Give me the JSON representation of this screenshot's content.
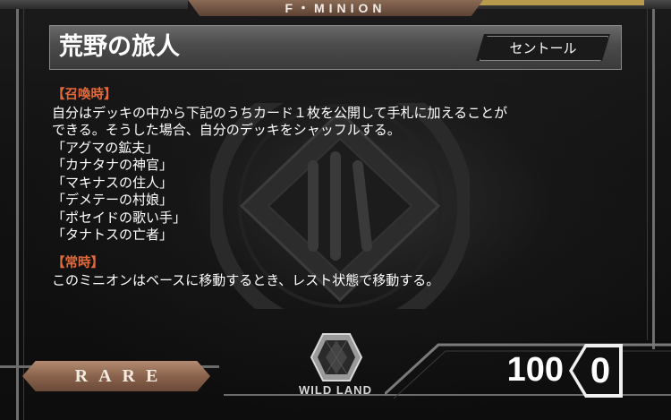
{
  "card": {
    "type": "F・MINION",
    "name": "荒野の旅人",
    "race": "セントール",
    "ability": {
      "summon_keyword": "【召喚時】",
      "summon_lines": [
        "自分はデッキの中から下記のうちカード１枚を公開して手札に加えることが",
        "できる。そうした場合、自分のデッキをシャッフルする。",
        "「アグマの鉱夫」",
        "「カナタナの神官」",
        "「マキナスの住人」",
        "「デメテーの村娘」",
        "「ポセイドの歌い手」",
        "「タナトスの亡者」"
      ],
      "constant_keyword": "【常時】",
      "constant_lines": [
        "このミニオンはベースに移動するとき、レスト状態で移動する。"
      ]
    },
    "rarity": "RARE",
    "set": "WILD LAND",
    "value": "100",
    "cost": "0"
  },
  "colors": {
    "keyword": "#e26a3a",
    "text": "#ffffff",
    "rarity_plate": "#8a634c"
  },
  "icons": {
    "emblem": "diamond-crest-icon",
    "gem": "hexagon-gem-icon"
  }
}
